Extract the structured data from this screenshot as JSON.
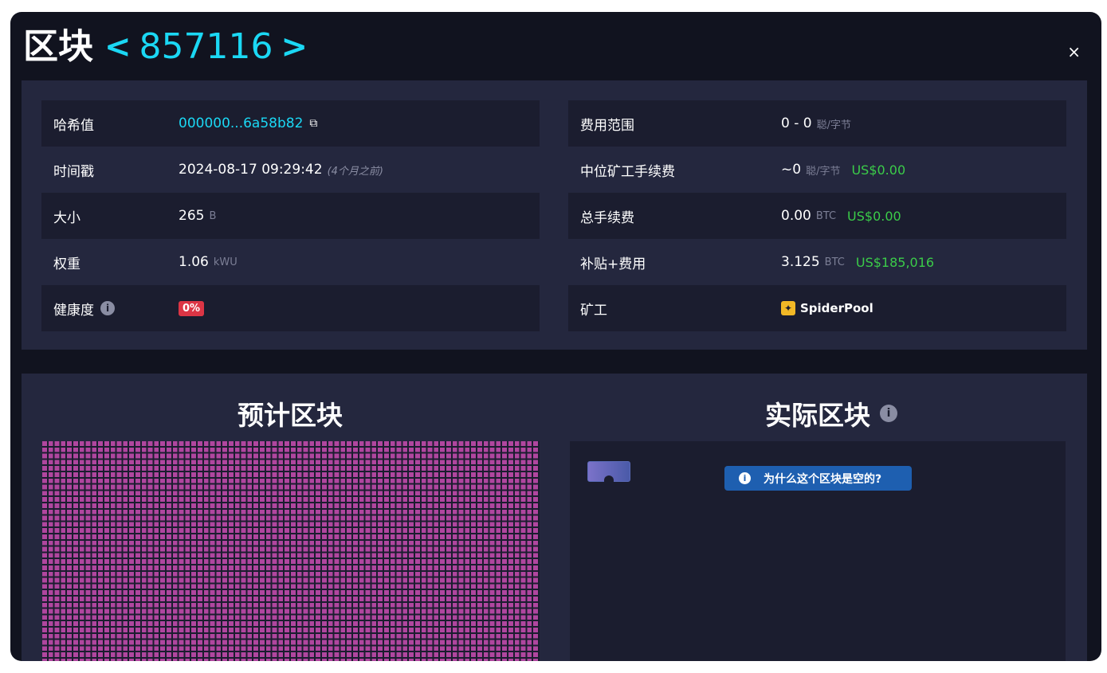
{
  "header": {
    "title": "区块",
    "prev": "<",
    "height": "857116",
    "next": ">",
    "close": "×"
  },
  "details_left": [
    {
      "label": "哈希值",
      "value": "000000...6a58b82"
    },
    {
      "label": "时间戳",
      "value": "2024-08-17 09:29:42",
      "ago": "(4个月之前)"
    },
    {
      "label": "大小",
      "value": "265",
      "unit": "B"
    },
    {
      "label": "权重",
      "value": "1.06",
      "unit": "kWU"
    },
    {
      "label": "健康度",
      "value": "0%"
    }
  ],
  "details_right": [
    {
      "label": "费用范围",
      "value": "0 - 0",
      "unit": "聪/字节"
    },
    {
      "label": "中位矿工手续费",
      "value": "~0",
      "unit": "聪/字节",
      "usd": "US$0.00"
    },
    {
      "label": "总手续费",
      "value": "0.00",
      "unit": "BTC",
      "usd": "US$0.00"
    },
    {
      "label": "补贴+费用",
      "value": "3.125",
      "unit": "BTC",
      "usd": "US$185,016"
    },
    {
      "label": "矿工",
      "value": "SpiderPool"
    }
  ],
  "visualization": {
    "projected_title": "预计区块",
    "actual_title": "实际区块",
    "why_empty_button": "为什么这个区块是空的?"
  },
  "colors": {
    "accent": "#1bd8f4",
    "usd_green": "#3bcc49",
    "health_red": "#dc3545",
    "tx_purple": "#b0469f",
    "button_blue": "#1e5fb0"
  },
  "icons": {
    "copy": "copy-icon",
    "info": "info-icon",
    "pool": "spiderpool-logo"
  }
}
